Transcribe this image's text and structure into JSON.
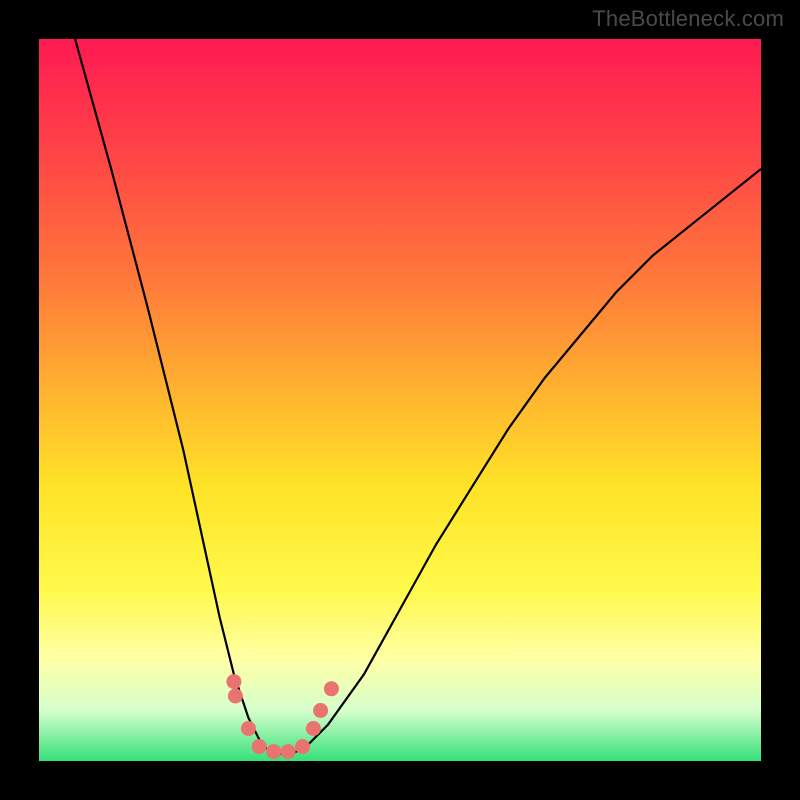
{
  "watermark": "TheBottleneck.com",
  "chart_data": {
    "type": "line",
    "title": "",
    "xlabel": "",
    "ylabel": "",
    "xlim": [
      0,
      100
    ],
    "ylim": [
      0,
      100
    ],
    "grid": false,
    "legend": false,
    "series": [
      {
        "name": "curve",
        "x": [
          5,
          10,
          15,
          20,
          25,
          27,
          29,
          31,
          33,
          35,
          37,
          40,
          45,
          50,
          55,
          60,
          65,
          70,
          75,
          80,
          85,
          90,
          95,
          100
        ],
        "y": [
          100,
          82,
          63,
          43,
          20,
          12,
          6,
          2,
          1,
          1,
          2,
          5,
          12,
          21,
          30,
          38,
          46,
          53,
          59,
          65,
          70,
          74,
          78,
          82
        ]
      }
    ],
    "markers": [
      {
        "x": 27.0,
        "y": 11.0
      },
      {
        "x": 27.2,
        "y": 9.0
      },
      {
        "x": 29.0,
        "y": 4.5
      },
      {
        "x": 30.5,
        "y": 2.0
      },
      {
        "x": 32.5,
        "y": 1.3
      },
      {
        "x": 34.5,
        "y": 1.3
      },
      {
        "x": 36.5,
        "y": 2.0
      },
      {
        "x": 38.0,
        "y": 4.5
      },
      {
        "x": 39.0,
        "y": 7.0
      },
      {
        "x": 40.5,
        "y": 10.0
      }
    ],
    "gradient_stops": [
      {
        "pos": 0.0,
        "color": "#ff1a52"
      },
      {
        "pos": 0.18,
        "color": "#ff4a45"
      },
      {
        "pos": 0.34,
        "color": "#ff7b3a"
      },
      {
        "pos": 0.48,
        "color": "#ffb030"
      },
      {
        "pos": 0.62,
        "color": "#ffe327"
      },
      {
        "pos": 0.76,
        "color": "#fff94a"
      },
      {
        "pos": 0.86,
        "color": "#ffffa6"
      },
      {
        "pos": 0.93,
        "color": "#d6ffcc"
      },
      {
        "pos": 1.0,
        "color": "#35e07a"
      }
    ]
  }
}
